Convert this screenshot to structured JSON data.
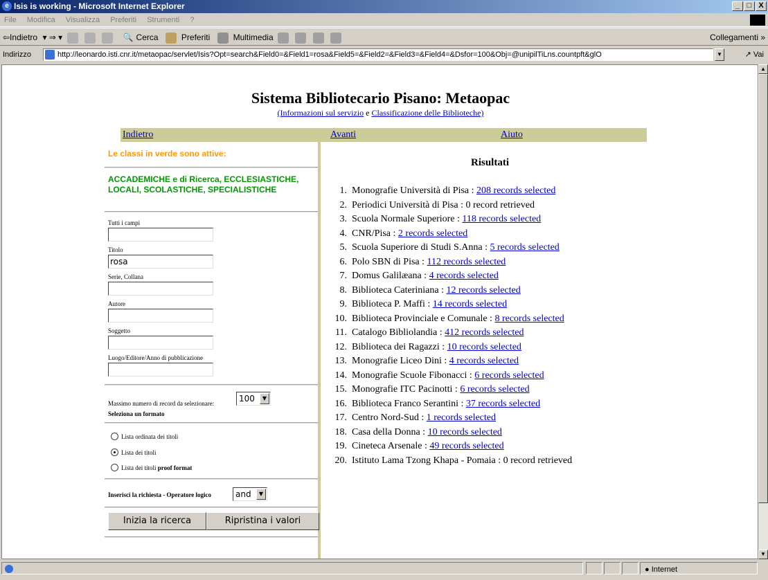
{
  "window": {
    "title": "Isis is working - Microsoft Internet Explorer",
    "buttons": [
      "_",
      "□",
      "X"
    ]
  },
  "menu": [
    "File",
    "Modifica",
    "Visualizza",
    "Preferiti",
    "Strumenti",
    "?"
  ],
  "toolbar": {
    "back": "⇦Indietro",
    "search": "Cerca",
    "favorites": "Preferiti",
    "multimedia": "Multimedia",
    "links": "Collegamenti »"
  },
  "address": {
    "label": "Indirizzo",
    "url": "http://leonardo.isti.cnr.it/metaopac/servlet/Isis?Opt=search&Field0=&Field1=rosa&Field5=&Field2=&Field3=&Field4=&Dsfor=100&Obj=@unipilTiLns.countpft&glO",
    "go": "Vai"
  },
  "page": {
    "title": "Sistema Bibliotecario Pisano: Metaopac",
    "info_link": "(Informazioni sul servizio",
    "and": "e",
    "class_link": "Classificazione delle Biblioteche)",
    "nav": {
      "back": "Indietro",
      "forward": "Avanti",
      "help": "Aiuto"
    }
  },
  "form": {
    "active_header": "Le classi in verde sono attive:",
    "active_classes": "ACCADEMICHE e di Ricerca, ECCLESIASTICHE, LOCALI, SCOLASTICHE, SPECIALISTICHE",
    "fields": [
      {
        "label": "Tutti i campi",
        "value": ""
      },
      {
        "label": "Titolo",
        "value": "rosa"
      },
      {
        "label": "Serie, Collana",
        "value": ""
      },
      {
        "label": "Autore",
        "value": ""
      },
      {
        "label": "Soggetto",
        "value": ""
      },
      {
        "label": "Luogo/Editore/Anno di pubblicazione",
        "value": ""
      }
    ],
    "max_label": "Massimo numero di record da selezionare:",
    "max_value": "100",
    "format_label": "Seleziona un formato",
    "formats": [
      {
        "label": "Lista ordinata dei titoli",
        "selected": false
      },
      {
        "label": "Lista dei titoli",
        "selected": true
      },
      {
        "label_a": "Lista dei titoli ",
        "label_b": "proof format",
        "selected": false
      }
    ],
    "operator_label": "Inserisci la richiesta - Operatore logico",
    "operator_value": "and",
    "submit": "Inizia la ricerca",
    "reset": "Ripristina i valori"
  },
  "results": {
    "title": "Risultati",
    "items": [
      {
        "n": "1.",
        "name": "Monografie Università di Pisa :",
        "link": "208 records selected"
      },
      {
        "n": "2.",
        "name": "Periodici Università di Pisa : 0 record retrieved",
        "link": ""
      },
      {
        "n": "3.",
        "name": "Scuola Normale Superiore :",
        "link": "118 records selected"
      },
      {
        "n": "4.",
        "name": "CNR/Pisa :",
        "link": "2 records selected"
      },
      {
        "n": "5.",
        "name": "Scuola Superiore di Studi S.Anna :",
        "link": "5 records selected"
      },
      {
        "n": "6.",
        "name": "Polo SBN di Pisa :",
        "link": "112 records selected"
      },
      {
        "n": "7.",
        "name": "Domus Galilæana :",
        "link": "4 records selected"
      },
      {
        "n": "8.",
        "name": "Biblioteca Cateriniana :",
        "link": "12 records selected"
      },
      {
        "n": "9.",
        "name": "Biblioteca P. Maffi :",
        "link": "14 records selected"
      },
      {
        "n": "10.",
        "name": "Biblioteca Provinciale e Comunale :",
        "link": "8 records selected"
      },
      {
        "n": "11.",
        "name": "Catalogo Bibliolandia :",
        "link": "412 records selected"
      },
      {
        "n": "12.",
        "name": "Biblioteca dei Ragazzi :",
        "link": "10 records selected"
      },
      {
        "n": "13.",
        "name": "Monografie Liceo Dini :",
        "link": "4 records selected"
      },
      {
        "n": "14.",
        "name": "Monografie Scuole Fibonacci :",
        "link": "6 records selected"
      },
      {
        "n": "15.",
        "name": "Monografie ITC Pacinotti :",
        "link": "6 records selected"
      },
      {
        "n": "16.",
        "name": "Biblioteca Franco Serantini :",
        "link": "37 records selected"
      },
      {
        "n": "17.",
        "name": "Centro Nord-Sud :",
        "link": "1 records selected"
      },
      {
        "n": "18.",
        "name": "Casa della Donna :",
        "link": "10 records selected"
      },
      {
        "n": "19.",
        "name": "Cineteca Arsenale :",
        "link": "49 records selected"
      },
      {
        "n": "20.",
        "name": "Istituto Lama Tzong Khapa - Pomaia : 0 record retrieved",
        "link": ""
      }
    ]
  },
  "status": {
    "zone": "Internet"
  }
}
